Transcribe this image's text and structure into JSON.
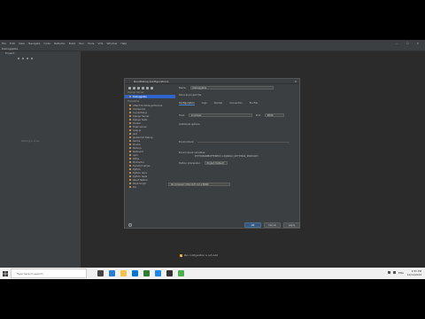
{
  "menubar": {
    "items": [
      "File",
      "Edit",
      "View",
      "Navigate",
      "Code",
      "Refactor",
      "Build",
      "Run",
      "Tools",
      "VCS",
      "Window",
      "Help"
    ],
    "controls": [
      "—",
      "☐",
      "✕"
    ]
  },
  "navbar": {
    "label": "Debuggable"
  },
  "project_panel": {
    "title": "Project",
    "empty_text": "Nothing to show"
  },
  "dialog": {
    "title": "Run/Debug Configurations",
    "close": "✕",
    "sidebar": {
      "section_app": "Django Server",
      "selected": "Debuggable",
      "section_templates": "Templates",
      "templates": [
        "Attach to Node.js/Chrome",
        "Compound",
        "Cucumber.js",
        "Django Server",
        "Django tests",
        "Docker",
        "Flask server",
        "Gulp.js",
        "Jest",
        "JavaScript Debug",
        "Karma",
        "Mocha",
        "Node.js",
        "Nodeunit",
        "npm",
        "NW.js",
        "Protractor",
        "Pyramid server",
        "Python",
        "Python docs",
        "Python tests",
        "React Native",
        "Shell Script",
        "tox"
      ]
    },
    "main": {
      "name_label": "Name:",
      "name_value": "Debuggable",
      "share_label": "Store as project file",
      "tabs": [
        "Configuration",
        "Logs",
        "Startup",
        "Connection",
        "EnvFile"
      ],
      "host_label": "Host:",
      "host_value": "localhost",
      "port_label": "Port:",
      "port_value": "8000",
      "options_label": "Additional options:",
      "tooltip": "Run browser: http://127.0.0.1:8000/",
      "env_label": "Environment",
      "vars_label": "Environment variables:",
      "vars_value": "PYTHONUNBUFFERED=1;DJANGO_SETTINGS_MODULE=",
      "interp_label": "Python interpreter:",
      "interp_value": "Project Default",
      "apply_label": "Apply",
      "warning": "Run configuration is not valid",
      "buttons": {
        "ok": "OK",
        "cancel": "Cancel",
        "apply": "Apply"
      },
      "help": "?"
    }
  },
  "statusbar": {
    "text": ""
  },
  "taskbar": {
    "search_placeholder": "Type here to search",
    "time": "4:55 PM",
    "date": "10/14/2019",
    "lang": "ENG"
  }
}
